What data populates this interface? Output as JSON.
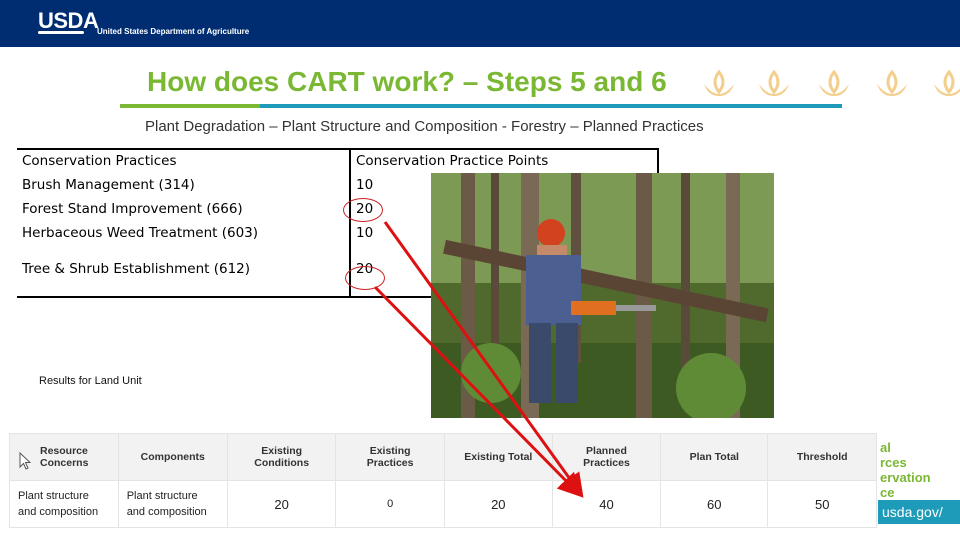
{
  "header": {
    "logo_text": "USDA",
    "agency_text": "United States Department of Agriculture"
  },
  "title": "How does CART work? – Steps 5 and 6",
  "subtitle": "Plant Degradation – Plant Structure and Composition - Forestry – Planned Practices",
  "practices_table": {
    "headers": [
      "Conservation Practices",
      "Conservation Practice Points"
    ],
    "rows": [
      {
        "practice": "Brush Management (314)",
        "points": "10"
      },
      {
        "practice": "Forest Stand Improvement (666)",
        "points": "20"
      },
      {
        "practice": "Herbaceous Weed Treatment (603)",
        "points": "10"
      },
      {
        "practice": "Tree & Shrub Establishment (612)",
        "points": "20"
      }
    ]
  },
  "results": {
    "label": "Results for Land Unit",
    "headers": [
      [
        "Resource",
        "Concerns"
      ],
      [
        "Components"
      ],
      [
        "Existing",
        "Conditions"
      ],
      [
        "Existing",
        "Practices"
      ],
      [
        "Existing Total"
      ],
      [
        "Planned",
        "Practices"
      ],
      [
        "Plan Total"
      ],
      [
        "Threshold"
      ]
    ],
    "row": {
      "resource_concern": [
        "Plant structure",
        "and composition"
      ],
      "component": [
        "Plant structure",
        "and composition"
      ],
      "existing_conditions": "20",
      "existing_practices": "0",
      "existing_total": "20",
      "planned_practices": "40",
      "plan_total": "60",
      "threshold": "50"
    }
  },
  "side_fragments": {
    "lines": [
      "al",
      "rces",
      "ervation",
      "ce"
    ],
    "url": "usda.gov/"
  },
  "colors": {
    "header_bg": "#002d72",
    "title_green": "#7ab834",
    "rule_teal": "#1d9bb8",
    "arrow_red": "#dd1111"
  },
  "icons": [
    "lotus-icon",
    "cursor-icon"
  ]
}
